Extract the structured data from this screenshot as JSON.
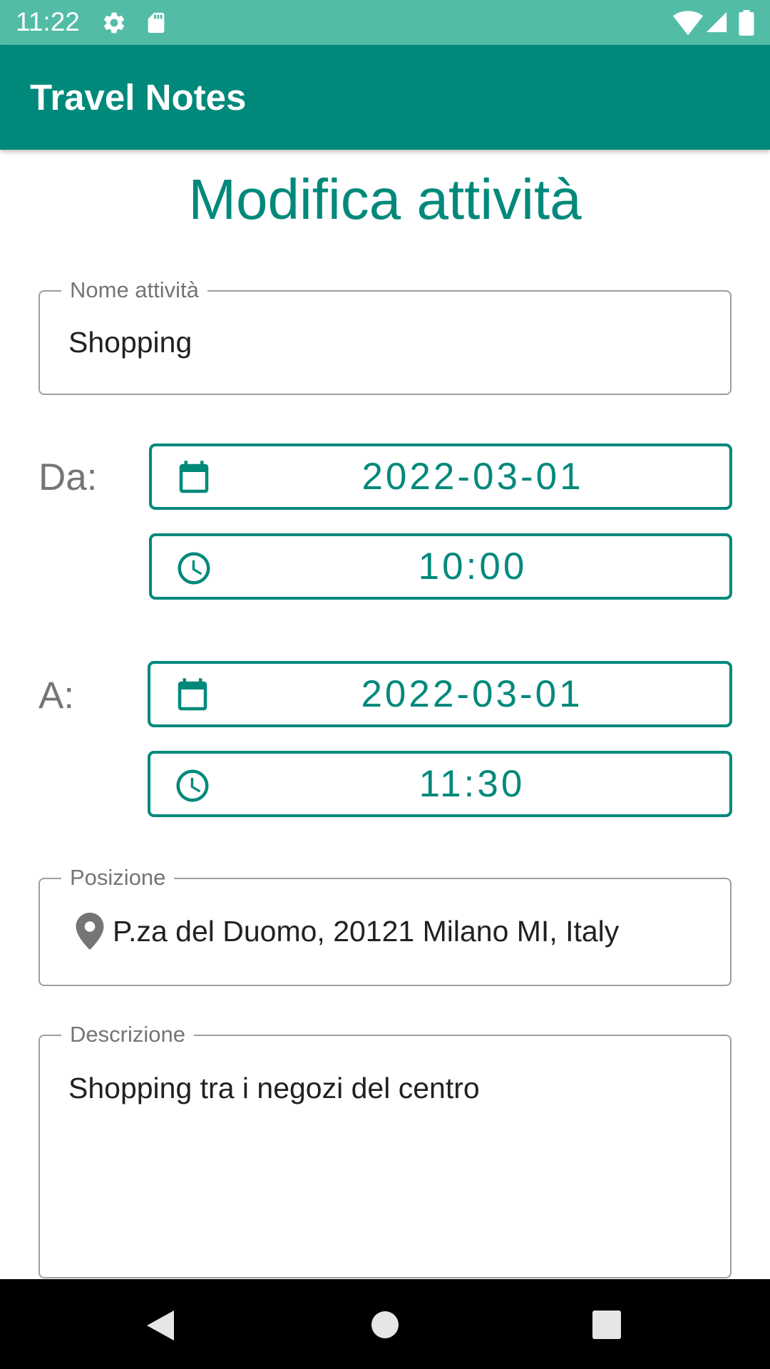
{
  "status_bar": {
    "time": "11:22",
    "icons": [
      "gear-icon",
      "sd-card-icon",
      "wifi-icon",
      "signal-icon",
      "battery-icon"
    ]
  },
  "app_bar": {
    "title": "Travel Notes"
  },
  "page": {
    "title": "Modifica attività"
  },
  "form": {
    "name": {
      "label": "Nome attività",
      "value": "Shopping"
    },
    "from": {
      "label": "Da:",
      "date": "2022-03-01",
      "time": "10:00"
    },
    "to": {
      "label": "A:",
      "date": "2022-03-01",
      "time": "11:30"
    },
    "position": {
      "label": "Posizione",
      "value": "P.za del Duomo, 20121 Milano MI, Italy"
    },
    "description": {
      "label": "Descrizione",
      "value": "Shopping tra i negozi del centro"
    }
  },
  "nav_bar": {
    "icons": [
      "back-icon",
      "home-icon",
      "recents-icon"
    ]
  },
  "colors": {
    "accent": "#00897b",
    "status_bar": "#52bca7",
    "outline": "#9e9e9e"
  }
}
